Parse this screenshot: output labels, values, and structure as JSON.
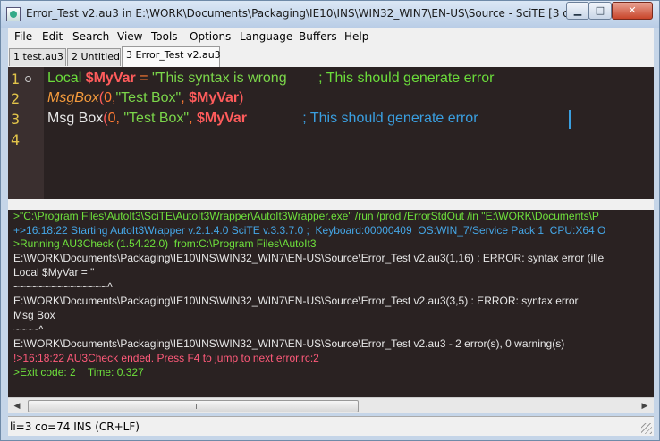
{
  "window": {
    "title": "Error_Test v2.au3 in E:\\WORK\\Documents\\Packaging\\IE10\\INS\\WIN32_WIN7\\EN-US\\Source - SciTE [3 of 3]",
    "min_glyph": "▁",
    "max_glyph": "□",
    "close_glyph": "✕"
  },
  "menu": [
    {
      "label": "File"
    },
    {
      "label": "Edit"
    },
    {
      "label": "Search"
    },
    {
      "label": "View"
    },
    {
      "label": "Tools"
    },
    {
      "label": "Options"
    },
    {
      "label": "Language"
    },
    {
      "label": "Buffers"
    },
    {
      "label": "Help"
    }
  ],
  "tabs": [
    {
      "label": "1 test.au3"
    },
    {
      "label": "2 Untitled"
    },
    {
      "label": "3 Error_Test v2.au3"
    }
  ],
  "editor": {
    "line_numbers": [
      "1",
      "2",
      "3",
      "4"
    ],
    "line1": {
      "kw": "Local ",
      "var": "$MyVar",
      "op": " = ",
      "str": "\"This syntax is wrong",
      "comment": "        ; This should generate error"
    },
    "line2": {
      "func": "MsgBox",
      "p1": "(",
      "num": "0",
      "comma": ",",
      "str": "\"Test Box\"",
      "comma2": ", ",
      "var": "$MyVar",
      "p2": ")"
    },
    "line3": {
      "text": "Msg Box",
      "p1": "(",
      "num": "0",
      "comma": ", ",
      "str": "\"Test Box\"",
      "comma2": ", ",
      "var": "$MyVar",
      "comment": "              ; This should generate error"
    }
  },
  "output": [
    {
      "text": ">\"C:\\Program Files\\AutoIt3\\SciTE\\AutoIt3Wrapper\\AutoIt3Wrapper.exe\" /run /prod /ErrorStdOut /in \"E:\\WORK\\Documents\\P",
      "color": "green"
    },
    {
      "text": "+>16:18:22 Starting AutoIt3Wrapper v.2.1.4.0 SciTE v.3.3.7.0 ;  Keyboard:00000409  OS:WIN_7/Service Pack 1  CPU:X64 O",
      "color": "blue"
    },
    {
      "text": ">Running AU3Check (1.54.22.0)  from:C:\\Program Files\\AutoIt3",
      "color": "green"
    },
    {
      "text": "E:\\WORK\\Documents\\Packaging\\IE10\\INS\\WIN32_WIN7\\EN-US\\Source\\Error_Test v2.au3(1,16) : ERROR: syntax error (ille",
      "color": "white"
    },
    {
      "text": "Local $MyVar = \"",
      "color": "white"
    },
    {
      "text": "~~~~~~~~~~~~~~~^",
      "color": "white"
    },
    {
      "text": "E:\\WORK\\Documents\\Packaging\\IE10\\INS\\WIN32_WIN7\\EN-US\\Source\\Error_Test v2.au3(3,5) : ERROR: syntax error",
      "color": "white"
    },
    {
      "text": "Msg Box",
      "color": "white"
    },
    {
      "text": "~~~~^",
      "color": "white"
    },
    {
      "text": "E:\\WORK\\Documents\\Packaging\\IE10\\INS\\WIN32_WIN7\\EN-US\\Source\\Error_Test v2.au3 - 2 error(s), 0 warning(s)",
      "color": "white"
    },
    {
      "text": "!>16:18:22 AU3Check ended. Press F4 to jump to next error.rc:2",
      "color": "pink"
    },
    {
      "text": ">Exit code: 2    Time: 0.327",
      "color": "green"
    }
  ],
  "scrollbar": {
    "left_arrow": "◀",
    "right_arrow": "▶"
  },
  "status": "li=3 co=74 INS (CR+LF)"
}
